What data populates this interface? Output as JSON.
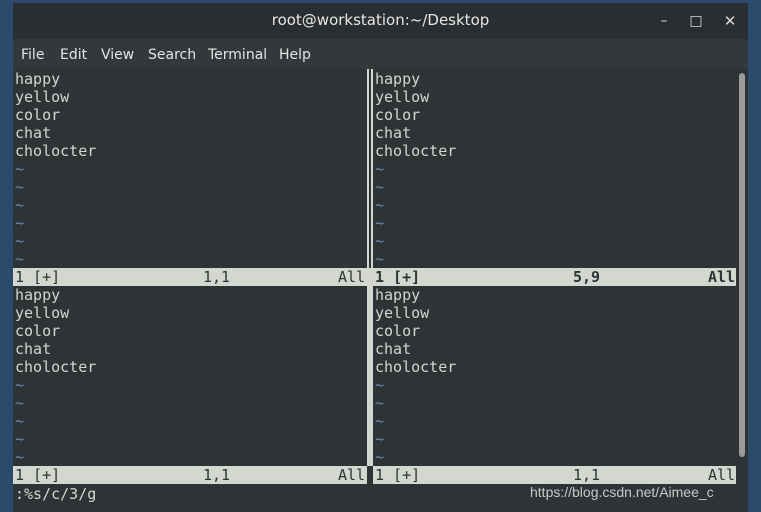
{
  "window": {
    "title": "root@workstation:~/Desktop",
    "controls": {
      "minimize": "–",
      "maximize": "□",
      "close": "✕"
    }
  },
  "menu": [
    "File",
    "Edit",
    "View",
    "Search",
    "Terminal",
    "Help"
  ],
  "panes": [
    {
      "id": "top-left",
      "lines": [
        "happy",
        "yellow",
        "color",
        "chat",
        "cholocter"
      ],
      "tilde_count": 6,
      "status": {
        "name": "1 [+]",
        "position": "1,1",
        "scroll": "All",
        "active": false
      }
    },
    {
      "id": "top-right",
      "lines": [
        "happy",
        "yellow",
        "color",
        "chat",
        "cholocter"
      ],
      "tilde_count": 6,
      "status": {
        "name": "1 [+]",
        "position": "5,9",
        "scroll": "All",
        "active": true
      }
    },
    {
      "id": "bottom-left",
      "lines": [
        "happy",
        "yellow",
        "color",
        "chat",
        "cholocter"
      ],
      "tilde_count": 5,
      "status": {
        "name": "1 [+]",
        "position": "1,1",
        "scroll": "All",
        "active": false
      }
    },
    {
      "id": "bottom-right",
      "lines": [
        "happy",
        "yellow",
        "color",
        "chat",
        "cholocter"
      ],
      "tilde_count": 5,
      "status": {
        "name": "1 [+]",
        "position": "1,1",
        "scroll": "All",
        "active": false
      }
    }
  ],
  "tilde": "~",
  "command_line": ":%s/c/3/g",
  "watermark": "https://blog.csdn.net/Aimee_c",
  "colors": {
    "terminal_bg": "#2e3436",
    "text": "#d3d7cf",
    "tilde": "#6b8bb5",
    "status_bg": "#d3d7cf"
  }
}
